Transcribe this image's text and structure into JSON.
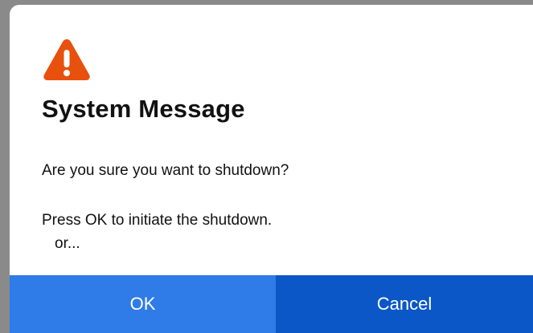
{
  "dialog": {
    "icon": "warning-icon",
    "icon_color": "#e8500e",
    "title": "System Message",
    "message_line1": "Are you sure you want to shutdown?",
    "message_line2": "Press OK to initiate the shutdown.",
    "message_line3": "or...",
    "ok_label": "OK",
    "cancel_label": "Cancel",
    "ok_color": "#2f7be8",
    "cancel_color": "#0b57c7"
  }
}
